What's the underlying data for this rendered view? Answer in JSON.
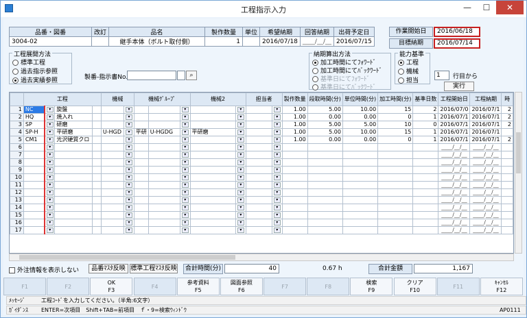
{
  "window": {
    "title": "工程指示入力",
    "min": "—",
    "max": "☐",
    "close": "✕"
  },
  "header": {
    "cols": [
      "品番・図番",
      "改訂",
      "品名",
      "製作数量",
      "単位",
      "希望納期",
      "回答納期",
      "出荷予定日"
    ],
    "values": [
      "3004-02",
      "",
      "継手本体（ボルト取付側）",
      "1",
      "",
      "2016/07/18",
      "____/__/__",
      "2016/07/15"
    ]
  },
  "dates": {
    "start_label": "作業開始日",
    "start_value": "2016/06/18",
    "target_label": "目標納期",
    "target_value": "2016/07/14"
  },
  "expand": {
    "title": "工程展開方法",
    "options": [
      "標準工程",
      "過去指示参照",
      "過去実績参照"
    ],
    "selected": 2
  },
  "ref": {
    "label": "製番-指示書No.",
    "search": "⌕"
  },
  "calc": {
    "title": "納期算出方法",
    "options": [
      "加工時間にてﾌｫﾜｰﾄﾞ",
      "加工時間にてﾊﾞｯｸﾜｰﾄﾞ",
      "基準日にてﾌｫﾜｰﾄﾞ",
      "基準日にてﾊﾞｯｸﾜｰﾄﾞ"
    ],
    "selected": 0
  },
  "capacity": {
    "title": "能力基準",
    "options": [
      "工程",
      "機械",
      "担当"
    ],
    "selected": 0
  },
  "row_from": {
    "value": "1",
    "label": "行目から",
    "exec": "実行"
  },
  "grid": {
    "headers": [
      "工程",
      "機械",
      "機械ｸﾞﾙｰﾌﾟ",
      "機械2",
      "担当者",
      "製作数量",
      "段取時間(分)",
      "単位時間(分)",
      "加工時間(分)",
      "基準日数",
      "工程開始日",
      "工程納期",
      "時"
    ],
    "rows": [
      {
        "no": "1",
        "code": "NC",
        "name": "旋盤",
        "machine": "",
        "group": "",
        "machine2": "",
        "staff": "",
        "qty": "1.00",
        "setup": "5.00",
        "unit": "10.00",
        "proc": "15",
        "days": "2",
        "start": "2016/07/0",
        "due": "2016/07/1",
        "h": "2"
      },
      {
        "no": "2",
        "code": "HQ",
        "name": "焼入れ",
        "machine": "",
        "group": "",
        "machine2": "",
        "staff": "",
        "qty": "1.00",
        "setup": "0.00",
        "unit": "0.00",
        "proc": "0",
        "days": "1",
        "start": "2016/07/1",
        "due": "2016/07/1",
        "h": "2"
      },
      {
        "no": "3",
        "code": "SP",
        "name": "研磨",
        "machine": "",
        "group": "",
        "machine2": "",
        "staff": "",
        "qty": "1.00",
        "setup": "5.00",
        "unit": "5.00",
        "proc": "10",
        "days": "0",
        "start": "2016/07/1",
        "due": "2016/07/1",
        "h": "2"
      },
      {
        "no": "4",
        "code": "SP-H",
        "name": "平研磨",
        "machine": "U-HGD",
        "group": "平研",
        "group_code": "U-HGDG",
        "machine2": "平研磨",
        "staff": "",
        "qty": "1.00",
        "setup": "5.00",
        "unit": "10.00",
        "proc": "15",
        "days": "1",
        "start": "2016/07/1",
        "due": "2016/07/1",
        "h": ""
      },
      {
        "no": "5",
        "code": "CM1",
        "name": "光沢硬質クロ",
        "machine": "",
        "group": "",
        "machine2": "",
        "staff": "",
        "qty": "1.00",
        "setup": "0.00",
        "unit": "0.00",
        "proc": "0",
        "days": "1",
        "start": "2016/07/1",
        "due": "2016/07/1",
        "h": "2"
      }
    ],
    "empty_rows": [
      "6",
      "7",
      "8",
      "9",
      "10",
      "11",
      "12",
      "13",
      "14",
      "15",
      "16",
      "17"
    ],
    "blank_date": "____/__/__"
  },
  "bottom": {
    "outside_label": "外注情報を表示しない",
    "btn_part_master": "品番ﾏｽﾀ反映",
    "btn_std_master": "標準工程ﾏｽﾀ反映",
    "total_time_label": "合計時間(分)",
    "total_time_value": "40",
    "hours": "0.67 h",
    "total_amount_label": "合計金額",
    "total_amount_value": "1,167"
  },
  "fkeys": [
    {
      "l1": "",
      "l2": "F1",
      "on": false
    },
    {
      "l1": "",
      "l2": "F2",
      "on": false
    },
    {
      "l1": "OK",
      "l2": "F3",
      "on": true
    },
    {
      "l1": "",
      "l2": "F4",
      "on": false
    },
    {
      "l1": "参考資料",
      "l2": "F5",
      "on": true
    },
    {
      "l1": "図面参照",
      "l2": "F6",
      "on": true
    },
    {
      "l1": "",
      "l2": "F7",
      "on": false
    },
    {
      "l1": "",
      "l2": "F8",
      "on": false
    },
    {
      "l1": "検索",
      "l2": "F9",
      "on": true
    },
    {
      "l1": "クリア",
      "l2": "F10",
      "on": true
    },
    {
      "l1": "",
      "l2": "F11",
      "on": false
    },
    {
      "l1": "ｷｬﾝｾﾙ",
      "l2": "F12",
      "on": true
    }
  ],
  "status": {
    "msg_label": "ﾒｯｾｰｼﾞ",
    "msg": "工程ｺｰﾄﾞを入力してください。（半角:6文字）",
    "guide_label": "ｶﾞｲﾀﾞﾝｽ",
    "guide": "ENTER=次項目　Shift+TAB=前項目　ｆ・9=検索ｳｨﾝﾄﾞｳ",
    "code": "AP0111"
  }
}
